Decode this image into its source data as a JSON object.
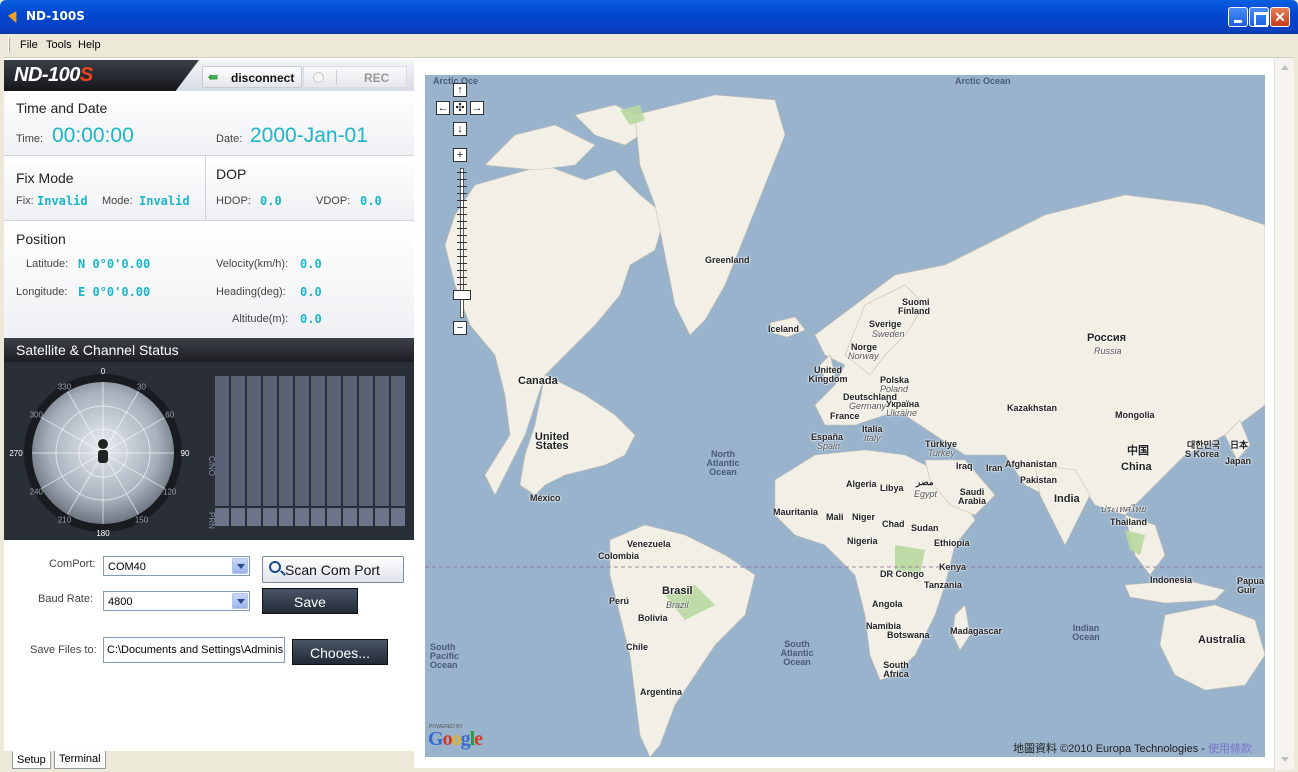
{
  "window": {
    "title": "ND-100S"
  },
  "menu": {
    "items": [
      "File",
      "Tools",
      "Help"
    ]
  },
  "header": {
    "brand_main": "ND-100",
    "brand_s": "S",
    "disconnect_label": "disconnect",
    "rec_label": "REC"
  },
  "time_date": {
    "title": "Time and Date",
    "time_label": "Time:",
    "time_value": "00:00:00",
    "date_label": "Date:",
    "date_value": "2000-Jan-01"
  },
  "fix_mode": {
    "title": "Fix Mode",
    "fix_label": "Fix:",
    "fix_value": "Invalid",
    "mode_label": "Mode:",
    "mode_value": "Invalid"
  },
  "dop": {
    "title": "DOP",
    "hdop_label": "HDOP:",
    "hdop_value": "0.0",
    "vdop_label": "VDOP:",
    "vdop_value": "0.0"
  },
  "position": {
    "title": "Position",
    "latitude_label": "Latitude:",
    "latitude_value": "N 0°0'0.00",
    "longitude_label": "Longitude:",
    "longitude_value": "E 0°0'0.00",
    "velocity_label": "Velocity(km/h):",
    "velocity_value": "0.0",
    "heading_label": "Heading(deg):",
    "heading_value": "0.0",
    "altitude_label": "Altitude(m):",
    "altitude_value": "0.0"
  },
  "satellite": {
    "title": "Satellite & Channel Status",
    "compass_labels": [
      "0",
      "30",
      "60",
      "90",
      "120",
      "150",
      "180",
      "210",
      "240",
      "270",
      "300",
      "330"
    ],
    "cno_label": "C/NO",
    "prn_label": "PRN",
    "channel_count": 12
  },
  "setup": {
    "comport_label": "ComPort:",
    "comport_value": "COM40",
    "scan_label": "Scan Com Port",
    "baud_label": "Baud Rate:",
    "baud_value": "4800",
    "save_label": "Save",
    "savefiles_label": "Save Files to:",
    "savefiles_value": "C:\\Documents and Settings\\Adminis",
    "choose_label": "Chooes..."
  },
  "tabs": [
    "Setup",
    "Terminal"
  ],
  "map": {
    "labels": {
      "arctic_ocean_left": "Arctic Oce",
      "arctic_ocean": "Arctic Ocean",
      "greenland": "Greenland",
      "iceland": "Iceland",
      "canada": "Canada",
      "united_states": "United States",
      "mexico": "México",
      "north_atlantic": "North Atlantic Ocean",
      "venezuela": "Venezuela",
      "colombia": "Colombia",
      "peru": "Perú",
      "brasil": "Brasil",
      "brazil": "Brazil",
      "bolivia": "Bolivia",
      "chile": "Chile",
      "argentina": "Argentina",
      "south_pacific": "South Pacific Ocean",
      "south_atlantic": "South Atlantic Ocean",
      "suomi": "Suomi",
      "finland": "Finland",
      "sverige": "Sverige",
      "sweden": "Sweden",
      "norge": "Norge",
      "norway": "Norway",
      "united_kingdom": "United Kingdom",
      "polska": "Polska",
      "poland": "Poland",
      "deutschland": "Deutschland",
      "germany": "Germany",
      "ukraina": "Україна",
      "ukraine": "Ukraine",
      "france": "France",
      "italia": "Italia",
      "italy": "Italy",
      "espana": "España",
      "spain": "Spain",
      "turkiye": "Türkiye",
      "turkey": "Turkey",
      "rossiya": "Россия",
      "russia": "Russia",
      "kazakhstan": "Kazakhstan",
      "mongolia": "Mongolia",
      "china_cn": "中国",
      "china": "China",
      "korea_kr": "대한민국",
      "s_korea": "S Korea",
      "japan_jp": "日本",
      "japan": "Japan",
      "iraq": "Iraq",
      "iran": "Iran",
      "afghanistan": "Afghanistan",
      "pakistan": "Pakistan",
      "india": "India",
      "thailand_th": "ประเทศไทย",
      "thailand": "Thailand",
      "algeria": "Algeria",
      "libya": "Libya",
      "misr": "مصر",
      "egypt": "Egypt",
      "saudi_arabia": "Saudi Arabia",
      "mauritania": "Mauritania",
      "mali": "Mali",
      "niger": "Niger",
      "chad": "Chad",
      "sudan": "Sudan",
      "nigeria": "Nigeria",
      "ethiopia": "Ethiopia",
      "kenya": "Kenya",
      "dr_congo": "DR Congo",
      "tanzania": "Tanzania",
      "angola": "Angola",
      "namibia": "Namibia",
      "botswana": "Botswana",
      "madagascar": "Madagascar",
      "south_africa": "South Africa",
      "indian_ocean": "Indian Ocean",
      "indonesia": "Indonesia",
      "papua": "Papua Guir",
      "australia": "Australia"
    },
    "powered_by": "POWERED BY",
    "google": "Google",
    "copyright_text": "地圖資料 ©2010 Europa Technologies - ",
    "terms_link": "使用條款"
  }
}
